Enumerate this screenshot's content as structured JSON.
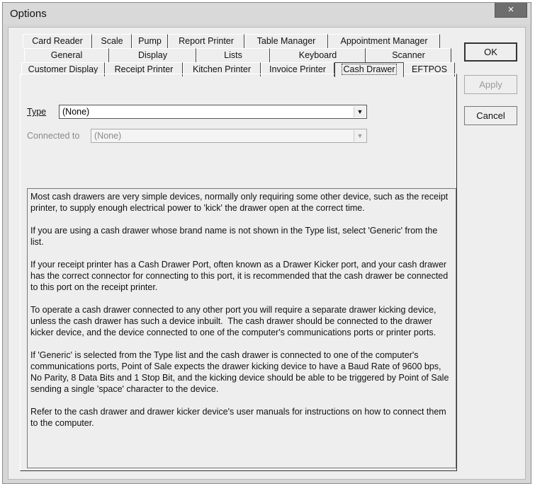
{
  "window": {
    "title": "Options",
    "close_glyph": "×"
  },
  "tabs": {
    "row1": [
      "Card Reader",
      "Scale",
      "Pump",
      "Report Printer",
      "Table Manager",
      "Appointment Manager"
    ],
    "row2": [
      "General",
      "Display",
      "Lists",
      "Keyboard",
      "Scanner"
    ],
    "row3": [
      "Customer Display",
      "Receipt Printer",
      "Kitchen Printer",
      "Invoice Printer",
      "Cash Drawer",
      "EFTPOS"
    ],
    "active": "Cash Drawer"
  },
  "form": {
    "type_label": "Type",
    "type_value": "(None)",
    "connected_label": "Connected to",
    "connected_value": "(None)",
    "dropdown_glyph": "▼"
  },
  "help_text": "Most cash drawers are very simple devices, normally only requiring some other device, such as the receipt printer, to supply enough electrical power to 'kick' the drawer open at the correct time.\n\nIf you are using a cash drawer whose brand name is not shown in the Type list, select 'Generic' from the list.\n\nIf your receipt printer has a Cash Drawer Port, often known as a Drawer Kicker port, and your cash drawer has the correct connector for connecting to this port, it is recommended that the cash drawer be connected to this port on the receipt printer.\n\nTo operate a cash drawer connected to any other port you will require a separate drawer kicking device, unless the cash drawer has such a device inbuilt.  The cash drawer should be connected to the drawer kicker device, and the device connected to one of the computer's communications ports or printer ports.\n\nIf 'Generic' is selected from the Type list and the cash drawer is connected to one of the computer's communications ports, Point of Sale expects the drawer kicking device to have a Baud Rate of 9600 bps, No Parity, 8 Data Bits and 1 Stop Bit, and the kicking device should be able to be triggered by Point of Sale sending a single 'space' character to the device.\n\nRefer to the cash drawer and drawer kicker device's user manuals for instructions on how to connect them to the computer.",
  "buttons": {
    "ok": "OK",
    "apply": "Apply",
    "cancel": "Cancel"
  }
}
